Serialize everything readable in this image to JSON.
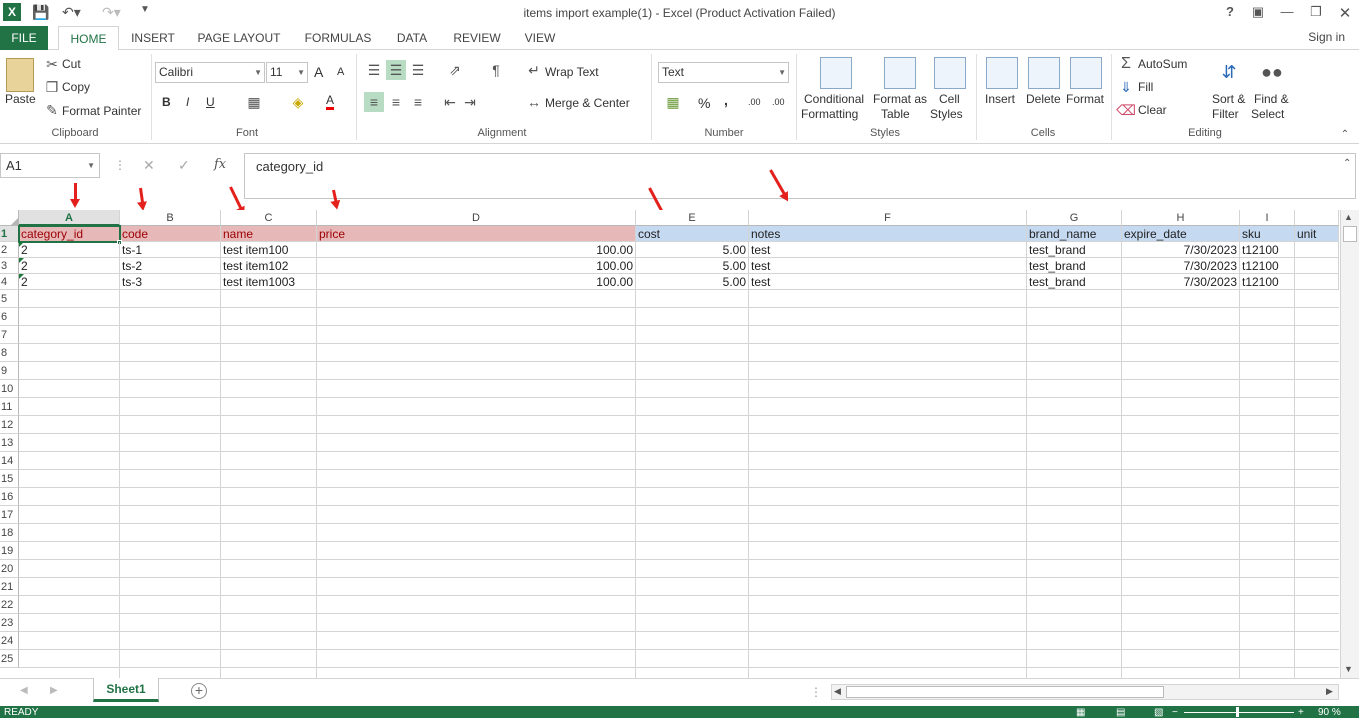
{
  "window": {
    "title": "items import example(1) - Excel (Product Activation Failed)",
    "help": "?",
    "sign_in": "Sign in"
  },
  "tabs": [
    {
      "label": "FILE"
    },
    {
      "label": "HOME"
    },
    {
      "label": "INSERT"
    },
    {
      "label": "PAGE LAYOUT"
    },
    {
      "label": "FORMULAS"
    },
    {
      "label": "DATA"
    },
    {
      "label": "REVIEW"
    },
    {
      "label": "VIEW"
    }
  ],
  "ribbon": {
    "clipboard": {
      "paste": "Paste",
      "cut": "Cut",
      "copy": "Copy",
      "format_painter": "Format Painter",
      "label": "Clipboard"
    },
    "font": {
      "name": "Calibri",
      "size": "11",
      "bold": "B",
      "italic": "I",
      "underline": "U",
      "grow": "A",
      "shrink": "A",
      "font_color": "A",
      "label": "Font"
    },
    "alignment": {
      "wrap_text": "Wrap Text",
      "merge_center": "Merge & Center",
      "label": "Alignment"
    },
    "number": {
      "format": "Text",
      "percent": "%",
      "comma": ",",
      "inc_decimal": ".00",
      "dec_decimal": ".00",
      "label": "Number"
    },
    "styles": {
      "conditional_1": "Conditional",
      "conditional_2": "Formatting",
      "format_table_1": "Format as",
      "format_table_2": "Table",
      "cell_styles_1": "Cell",
      "cell_styles_2": "Styles",
      "label": "Styles"
    },
    "cells": {
      "insert": "Insert",
      "delete": "Delete",
      "format": "Format",
      "label": "Cells"
    },
    "editing": {
      "autosum": "AutoSum",
      "fill": "Fill",
      "clear": "Clear",
      "sort_1": "Sort &",
      "sort_2": "Filter",
      "find_1": "Find &",
      "find_2": "Select",
      "label": "Editing"
    }
  },
  "formula_bar": {
    "name_box": "A1",
    "fx": "fx",
    "value": "category_id"
  },
  "grid": {
    "columns": [
      "A",
      "B",
      "C",
      "D",
      "E",
      "F",
      "G",
      "H",
      "I"
    ],
    "header_row": [
      "category_id",
      "code",
      "name",
      "price",
      "cost",
      "notes",
      "brand_name",
      "expire_date",
      "sku",
      "unit"
    ],
    "rows": [
      [
        "2",
        "ts-1",
        "test item100",
        "100.00",
        "5.00",
        "test",
        "test_brand",
        "7/30/2023",
        "t12100"
      ],
      [
        "2",
        "ts-2",
        "test item102",
        "100.00",
        "5.00",
        "test",
        "test_brand",
        "7/30/2023",
        "t12100"
      ],
      [
        "2",
        "ts-3",
        "test item1003",
        "100.00",
        "5.00",
        "test",
        "test_brand",
        "7/30/2023",
        "t12100"
      ]
    ],
    "row_numbers": [
      "1",
      "2",
      "3",
      "4",
      "5",
      "6",
      "7",
      "8",
      "9",
      "10",
      "11",
      "12",
      "13",
      "14",
      "15",
      "16",
      "17",
      "18",
      "19",
      "20",
      "21",
      "22",
      "23",
      "24",
      "25"
    ]
  },
  "sheet_tabs": [
    {
      "label": "Sheet1"
    }
  ],
  "add_sheet": "+",
  "status": {
    "text": "READY",
    "zoom": "90 %"
  },
  "colors": {
    "accent": "#217346",
    "pink_fill": "#e6b8b7",
    "pink_text": "#9c0006",
    "blue_fill": "#c5d9f1",
    "arrow": "#e3201b"
  }
}
